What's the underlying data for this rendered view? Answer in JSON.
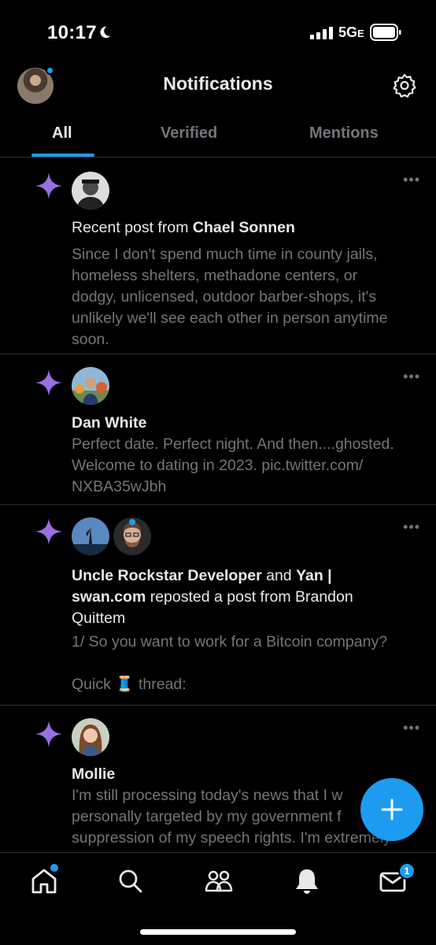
{
  "status_bar": {
    "time": "10:17",
    "network": "5G",
    "network_suffix": "E"
  },
  "header": {
    "title": "Notifications",
    "avatar_icon": "profile-avatar",
    "settings_icon": "gear-icon"
  },
  "tabs": [
    {
      "label": "All",
      "active": true
    },
    {
      "label": "Verified",
      "active": false
    },
    {
      "label": "Mentions",
      "active": false
    }
  ],
  "notifications": [
    {
      "prefix": "Recent post from ",
      "name": "Chael Sonnen",
      "body": [
        "Since I don't spend much time in county jails,",
        "homeless shelters, methadone centers, or",
        "dodgy, unlicensed, outdoor barber-shops, it's",
        "unlikely we'll see each other in person anytime",
        "soon."
      ]
    },
    {
      "name": "Dan White",
      "body": [
        "Perfect date. Perfect night. And then....ghosted.",
        "Welcome to dating in 2023. pic.twitter.com/",
        "NXBA35wJbh"
      ]
    },
    {
      "name1": "Uncle Rockstar Developer",
      "joiner": " and ",
      "name2_part1": "Yan |",
      "name2_part2": "swan.com",
      "action_part1": " reposted a post from Brandon",
      "action_part2": "Quittem",
      "body1": "1/ So you want to work for a Bitcoin company?",
      "body2_before": "Quick ",
      "body2_emoji": "🧵",
      "body2_after": " thread:"
    },
    {
      "name": "Mollie",
      "body": [
        "I'm still processing today's news that I w",
        "personally targeted by my government f",
        "suppression of my speech rights. I'm extremely"
      ]
    }
  ],
  "fab": {
    "label": "+"
  },
  "bottom_nav": {
    "items": [
      "home-icon",
      "search-icon",
      "communities-icon",
      "notifications-bell-icon",
      "messages-icon"
    ],
    "messages_badge": "1"
  },
  "colors": {
    "accent": "#1d9bf0",
    "sparkle": "#9b6fe3",
    "muted": "#71767b",
    "text": "#e7e9ea"
  }
}
